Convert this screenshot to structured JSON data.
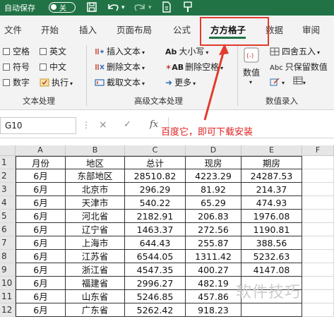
{
  "title_bar": {
    "autosave_label": "自动保存",
    "toggle_label": "关",
    "icons": [
      "save-icon",
      "undo-icon",
      "redo-icon",
      "file-icon",
      "brush-icon"
    ],
    "bg_color": "#217346"
  },
  "tabs": [
    "文件",
    "开始",
    "插入",
    "页面布局",
    "公式",
    "方方格子",
    "数据",
    "审阅"
  ],
  "active_tab": "方方格子",
  "ribbon": {
    "text_process": {
      "checks": [
        "空格",
        "英文",
        "符号",
        "中文",
        "数字"
      ],
      "execute": "执行",
      "group_label": "文本处理"
    },
    "advanced_text": {
      "insert": "插入文本",
      "delete": "删除文本",
      "extract": "截取文本",
      "case": "大小写",
      "delete_space": "删除空格",
      "more": "更多",
      "group_label": "高级文本处理"
    },
    "number_entry": {
      "value_btn": "数值",
      "round": "四舍五入",
      "keep_decimal": "只保留数值",
      "group_label": "数值录入"
    }
  },
  "formula_bar": {
    "name_box": "G10",
    "cancel_glyph": "×",
    "confirm_glyph": "✓",
    "fx_label": "fx"
  },
  "grid": {
    "columns": [
      "A",
      "B",
      "C",
      "D",
      "E",
      "F"
    ],
    "row_numbers": [
      "1",
      "2",
      "3",
      "4",
      "5",
      "6",
      "7",
      "8",
      "9",
      "10",
      "11",
      "12"
    ],
    "rows": [
      [
        "月份",
        "地区",
        "总计",
        "现房",
        "期房"
      ],
      [
        "6月",
        "东部地区",
        "28510.82",
        "4223.29",
        "24287.53"
      ],
      [
        "6月",
        "北京市",
        "296.29",
        "81.92",
        "214.37"
      ],
      [
        "6月",
        "天津市",
        "540.22",
        "65.29",
        "474.93"
      ],
      [
        "6月",
        "河北省",
        "2182.91",
        "206.83",
        "1976.08"
      ],
      [
        "6月",
        "辽宁省",
        "1463.37",
        "272.56",
        "1190.81"
      ],
      [
        "6月",
        "上海市",
        "644.43",
        "255.87",
        "388.56"
      ],
      [
        "6月",
        "江苏省",
        "6544.05",
        "1311.42",
        "5232.63"
      ],
      [
        "6月",
        "浙江省",
        "4547.35",
        "400.27",
        "4147.08"
      ],
      [
        "6月",
        "福建省",
        "2996.27",
        "482.19",
        ""
      ],
      [
        "6月",
        "山东省",
        "5246.85",
        "457.86",
        ""
      ],
      [
        "6月",
        "广东省",
        "5262.42",
        "918.23",
        ""
      ]
    ]
  },
  "annotation": {
    "text": "百度它，即可下载安装",
    "color": "#e02020"
  },
  "watermark": "软件技巧"
}
